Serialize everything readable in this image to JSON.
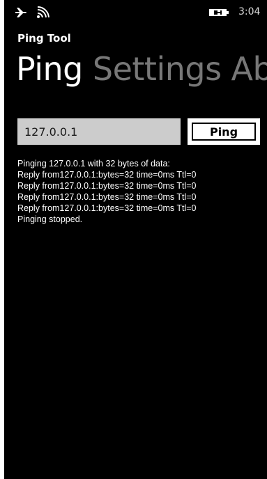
{
  "status_bar": {
    "time": "3:04",
    "icons": [
      "airplane-icon",
      "wifi-icon",
      "battery-charging-icon"
    ]
  },
  "app": {
    "title": "Ping Tool"
  },
  "pivot": {
    "tabs": [
      {
        "label": "Ping",
        "active": true
      },
      {
        "label": "Settings",
        "active": false
      },
      {
        "label": "About",
        "active": false
      }
    ]
  },
  "ping_form": {
    "host_value": "127.0.0.1",
    "button_label": "Ping"
  },
  "output": {
    "lines": [
      "Pinging 127.0.0.1 with 32 bytes of data:",
      "Reply from127.0.0.1:bytes=32 time=0ms Ttl=0",
      "Reply from127.0.0.1:bytes=32 time=0ms Ttl=0",
      "Reply from127.0.0.1:bytes=32 time=0ms Ttl=0",
      "Reply from127.0.0.1:bytes=32 time=0ms Ttl=0",
      "Pinging stopped."
    ]
  },
  "colors": {
    "background": "#000000",
    "foreground": "#ffffff",
    "inactive_tab": "#777777",
    "input_background": "#cccccc"
  }
}
